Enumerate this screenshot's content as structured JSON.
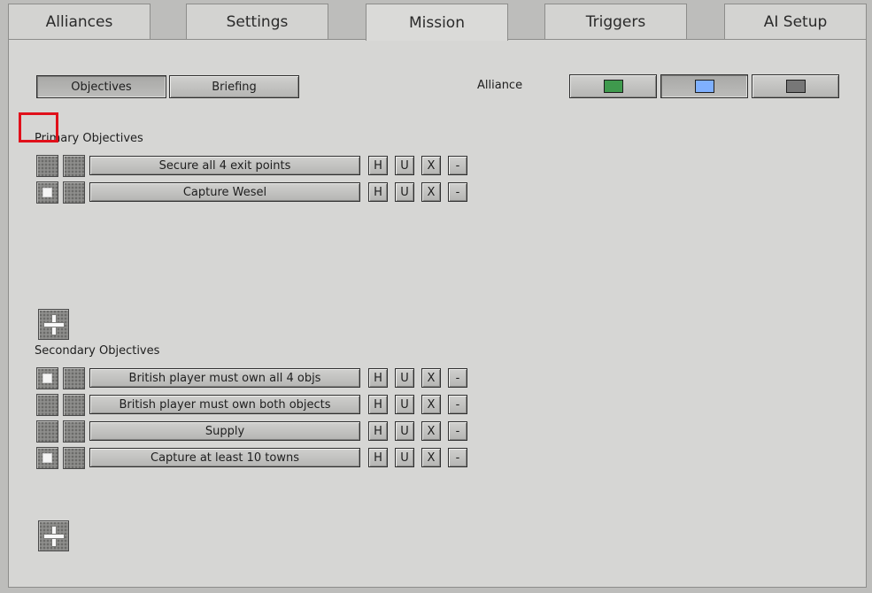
{
  "tabs": [
    {
      "label": "Alliances"
    },
    {
      "label": "Settings"
    },
    {
      "label": "Mission",
      "active": true
    },
    {
      "label": "Triggers"
    },
    {
      "label": "AI Setup"
    }
  ],
  "subtabs": {
    "objectives": "Objectives",
    "briefing": "Briefing"
  },
  "alliance": {
    "label": "Alliance",
    "swatches": [
      {
        "color": "#3f9a4d",
        "icon": "green-swatch"
      },
      {
        "color": "#7fb0ff",
        "icon": "blue-swatch"
      },
      {
        "color": "#777777",
        "icon": "gray-swatch"
      }
    ]
  },
  "primary": {
    "title": "Primary Objectives",
    "items": [
      {
        "name": "Secure all 4 exit points",
        "checked": false
      },
      {
        "name": "Capture Wesel",
        "checked": true
      }
    ]
  },
  "secondary": {
    "title": "Secondary Objectives",
    "items": [
      {
        "name": "British player must own all 4 objs",
        "checked": true
      },
      {
        "name": "British player must own both objects",
        "checked": false
      },
      {
        "name": "Supply",
        "checked": false
      },
      {
        "name": "Capture at least 10 towns",
        "checked": true
      }
    ]
  },
  "row_actions": {
    "h": "H",
    "u": "U",
    "x": "X",
    "minus": "-"
  }
}
